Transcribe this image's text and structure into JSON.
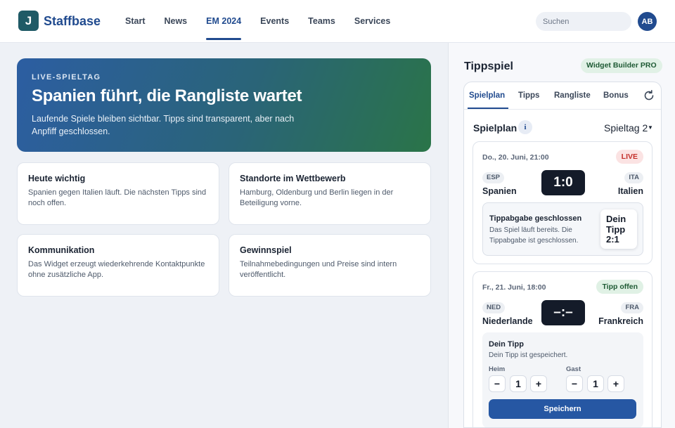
{
  "app": {
    "logo_letter": "J",
    "brand": "Staffbase",
    "nav": [
      "Start",
      "News",
      "EM 2024",
      "Events",
      "Teams",
      "Services"
    ],
    "active_nav": "EM 2024",
    "search_placeholder": "Suchen",
    "avatar_initials": "AB"
  },
  "hero": {
    "eyebrow": "LIVE-SPIELTAG",
    "title": "Spanien führt, die Rangliste wartet",
    "text": "Laufende Spiele bleiben sichtbar. Tipps sind transparent, aber nach Anpfiff geschlossen."
  },
  "cards": [
    {
      "title": "Heute wichtig",
      "text": "Spanien gegen Italien läuft. Die nächsten Tipps sind noch offen."
    },
    {
      "title": "Standorte im Wettbewerb",
      "text": "Hamburg, Oldenburg und Berlin liegen in der Beteiligung vorne."
    },
    {
      "title": "Kommunikation",
      "text": "Das Widget erzeugt wiederkehrende Kontaktpunkte ohne zusätzliche App."
    },
    {
      "title": "Gewinnspiel",
      "text": "Teilnahmebedingungen und Preise sind intern veröffentlicht."
    }
  ],
  "panel": {
    "title": "Tippspiel",
    "badge": "Widget Builder PRO",
    "tabs": [
      "Spielplan",
      "Tipps",
      "Rangliste",
      "Bonus"
    ],
    "active_tab": "Spielplan",
    "section_title": "Spielplan",
    "info_label": "i",
    "matchday": "Spieltag 2",
    "matches": [
      {
        "date": "Do., 20. Juni, 21:00",
        "status": "LIVE",
        "home_code": "ESP",
        "home": "Spanien",
        "away_code": "ITA",
        "away": "Italien",
        "score": "1:0",
        "closed_title": "Tippabgabe geschlossen",
        "closed_text": "Das Spiel läuft bereits. Die Tippabgabe ist geschlossen.",
        "my_tip_label": "Dein Tipp",
        "my_tip": "2:1"
      },
      {
        "date": "Fr., 21. Juni, 18:00",
        "status": "Tipp offen",
        "home_code": "NED",
        "home": "Niederlande",
        "away_code": "FRA",
        "away": "Frankreich",
        "score": "–:–",
        "tip_title": "Dein Tipp",
        "tip_saved": "Dein Tipp ist gespeichert.",
        "home_label": "Heim",
        "away_label": "Gast",
        "home_value": "1",
        "away_value": "1",
        "minus": "−",
        "plus": "+",
        "save_label": "Speichern"
      }
    ]
  },
  "colors": {
    "brand": "#214b8f",
    "live": "#c4302b",
    "open": "#1e5a34",
    "hero_start": "#2c5ea2",
    "hero_end": "#2a7448"
  }
}
